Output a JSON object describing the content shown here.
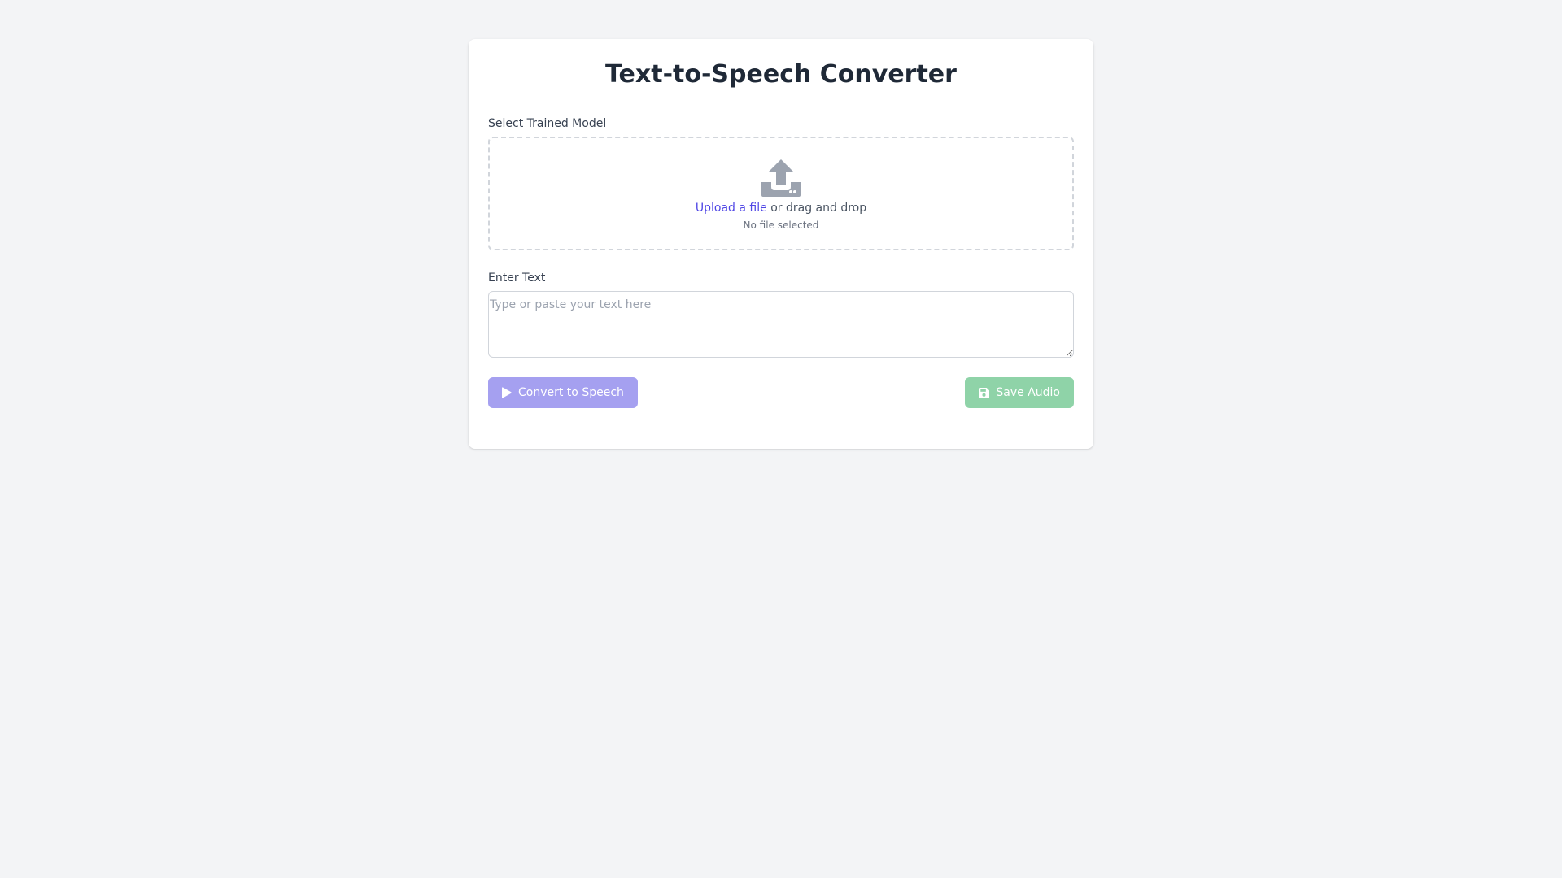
{
  "page": {
    "title": "Text-to-Speech Converter"
  },
  "model": {
    "label": "Select Trained Model",
    "upload_link": "Upload a file",
    "upload_rest": " or drag and drop",
    "file_status": "No file selected",
    "icon": "upload-icon"
  },
  "text": {
    "label": "Enter Text",
    "placeholder": "Type or paste your text here",
    "value": ""
  },
  "actions": {
    "convert_label": "Convert to Speech",
    "convert_icon": "play-icon",
    "save_label": "Save Audio",
    "save_icon": "save-icon"
  },
  "colors": {
    "background": "#f3f4f6",
    "card": "#ffffff",
    "link": "#4f46e5",
    "convert_button": "#a5a0f0",
    "save_button": "#8fd3a8"
  }
}
